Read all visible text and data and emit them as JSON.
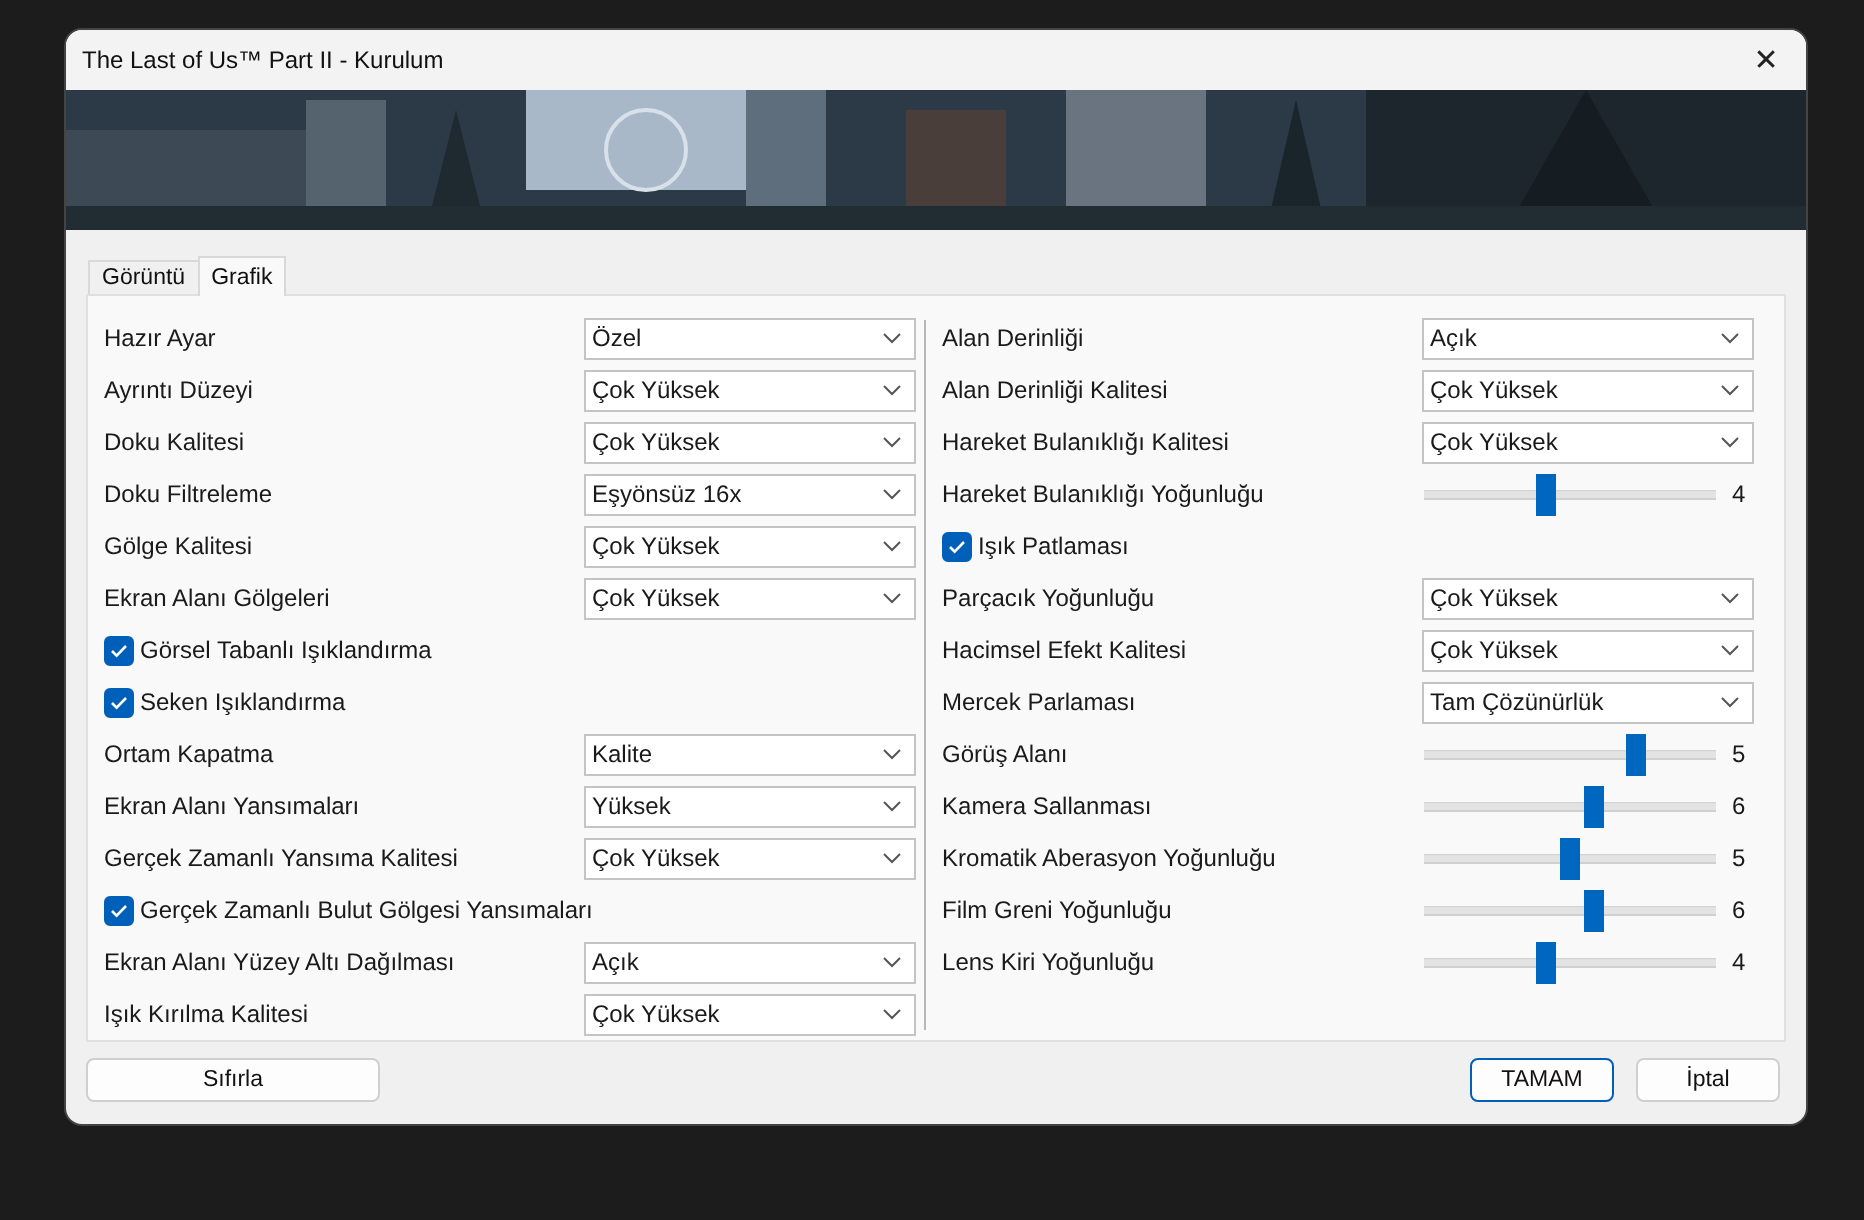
{
  "window": {
    "title": "The Last of Us™ Part II - Kurulum",
    "close": "✕"
  },
  "tabs": [
    {
      "label": "Görüntü",
      "selected": false
    },
    {
      "label": "Grafik",
      "selected": true
    }
  ],
  "left": [
    {
      "kind": "combo",
      "label": "Hazır Ayar",
      "value": "Özel"
    },
    {
      "kind": "combo",
      "label": "Ayrıntı Düzeyi",
      "value": "Çok Yüksek"
    },
    {
      "kind": "combo",
      "label": "Doku Kalitesi",
      "value": "Çok Yüksek"
    },
    {
      "kind": "combo",
      "label": "Doku Filtreleme",
      "value": "Eşyönsüz 16x"
    },
    {
      "kind": "combo",
      "label": "Gölge Kalitesi",
      "value": "Çok Yüksek"
    },
    {
      "kind": "combo",
      "label": "Ekran Alanı Gölgeleri",
      "value": "Çok Yüksek"
    },
    {
      "kind": "checkbox",
      "label": "Görsel Tabanlı Işıklandırma",
      "checked": true
    },
    {
      "kind": "checkbox",
      "label": "Seken Işıklandırma",
      "checked": true
    },
    {
      "kind": "combo",
      "label": "Ortam Kapatma",
      "value": "Kalite"
    },
    {
      "kind": "combo",
      "label": "Ekran Alanı Yansımaları",
      "value": "Yüksek"
    },
    {
      "kind": "combo",
      "label": "Gerçek Zamanlı Yansıma Kalitesi",
      "value": "Çok Yüksek"
    },
    {
      "kind": "checkbox",
      "label": "Gerçek Zamanlı Bulut Gölgesi Yansımaları",
      "checked": true
    },
    {
      "kind": "combo",
      "label": "Ekran Alanı Yüzey Altı Dağılması",
      "value": "Açık"
    },
    {
      "kind": "combo",
      "label": "Işık Kırılma Kalitesi",
      "value": "Çok Yüksek"
    }
  ],
  "right": [
    {
      "kind": "combo",
      "label": "Alan Derinliği",
      "value": "Açık"
    },
    {
      "kind": "combo",
      "label": "Alan Derinliği Kalitesi",
      "value": "Çok Yüksek"
    },
    {
      "kind": "combo",
      "label": "Hareket Bulanıklığı Kalitesi",
      "value": "Çok Yüksek"
    },
    {
      "kind": "slider",
      "label": "Hareket Bulanıklığı Yoğunluğu",
      "level": 0.41,
      "reading": "4"
    },
    {
      "kind": "checkbox",
      "label": "Işık Patlaması",
      "checked": true
    },
    {
      "kind": "combo",
      "label": "Parçacık Yoğunluğu",
      "value": "Çok Yüksek"
    },
    {
      "kind": "combo",
      "label": "Hacimsel Efekt Kalitesi",
      "value": "Çok Yüksek"
    },
    {
      "kind": "combo",
      "label": "Mercek Parlaması",
      "value": "Tam Çözünürlük"
    },
    {
      "kind": "slider",
      "label": "Görüş Alanı",
      "level": 0.74,
      "reading": "5"
    },
    {
      "kind": "slider",
      "label": "Kamera Sallanması",
      "level": 0.59,
      "reading": "6"
    },
    {
      "kind": "slider",
      "label": "Kromatik Aberasyon Yoğunluğu",
      "level": 0.5,
      "reading": "5"
    },
    {
      "kind": "slider",
      "label": "Film Greni Yoğunluğu",
      "level": 0.59,
      "reading": "6"
    },
    {
      "kind": "slider",
      "label": "Lens Kiri Yoğunluğu",
      "level": 0.41,
      "reading": "4"
    }
  ],
  "buttons": [
    {
      "kind": "reset",
      "label": "Sıfırla"
    },
    {
      "kind": "default",
      "label": "TAMAM"
    },
    {
      "kind": "normal",
      "label": "İptal"
    }
  ]
}
